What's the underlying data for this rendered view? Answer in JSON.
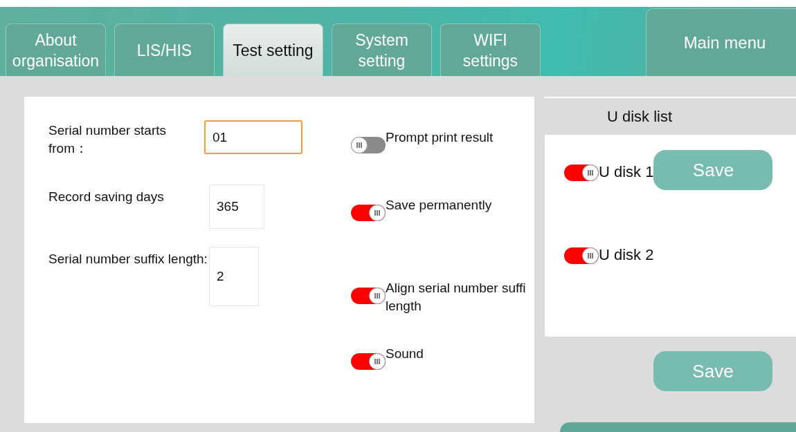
{
  "tabs": [
    {
      "label": "About\norganisation",
      "selected": false
    },
    {
      "label": "LIS/HIS",
      "selected": false
    },
    {
      "label": "Test setting",
      "selected": true
    },
    {
      "label": "System\nsetting",
      "selected": false
    },
    {
      "label": "WIFI\nsettings",
      "selected": false
    }
  ],
  "main_menu": "Main menu",
  "fields": [
    {
      "label": "Serial number starts from：",
      "value": "01",
      "focused": true
    },
    {
      "label": "Record saving days",
      "value": "365",
      "focused": false
    },
    {
      "label": "Serial number suffix length:",
      "value": "2",
      "focused": false
    }
  ],
  "toggles": [
    {
      "label": "Prompt print result",
      "on": false
    },
    {
      "label": "Save permanently",
      "on": true
    },
    {
      "label": "Align serial number suffi\nlength",
      "on": true
    },
    {
      "label": "Sound",
      "on": true
    }
  ],
  "u_disk": {
    "title": "U disk list",
    "items": [
      {
        "label": "U disk 1",
        "on": true
      },
      {
        "label": "U disk 2",
        "on": true
      }
    ],
    "save": "Save"
  },
  "save": "Save"
}
